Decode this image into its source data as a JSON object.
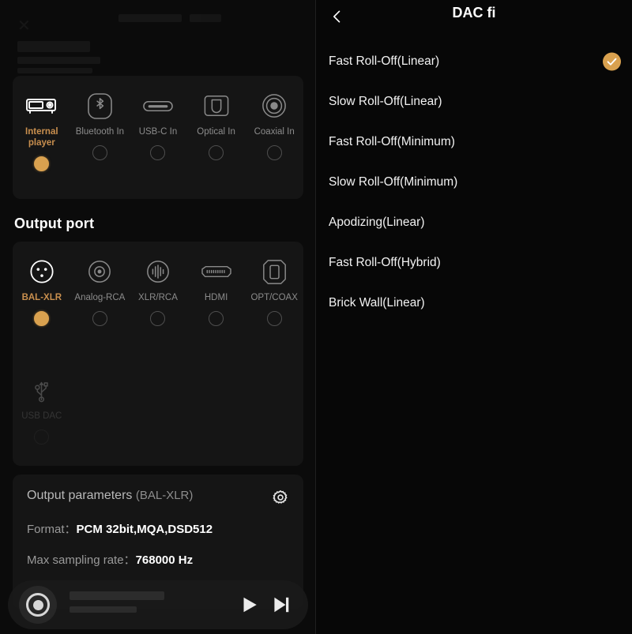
{
  "theme": {
    "accent": "#d9a14f",
    "accent_text": "#c98f4e",
    "bg": "#0b0b0b",
    "card_bg": "#151515",
    "text_primary": "#ffffff",
    "text_secondary": "#9a9a9a",
    "text_dim": "#5a5a5a"
  },
  "left": {
    "input_sources": [
      {
        "label": "Internal player",
        "icon": "dap-player-icon",
        "selected": true,
        "enabled": true
      },
      {
        "label": "Bluetooth In",
        "icon": "bluetooth-icon",
        "selected": false,
        "enabled": true
      },
      {
        "label": "USB-C In",
        "icon": "usb-c-icon",
        "selected": false,
        "enabled": true
      },
      {
        "label": "Optical In",
        "icon": "optical-icon",
        "selected": false,
        "enabled": true
      },
      {
        "label": "Coaxial In",
        "icon": "coaxial-icon",
        "selected": false,
        "enabled": true
      }
    ],
    "output_section_title": "Output port",
    "output_ports": [
      {
        "label": "BAL-XLR",
        "icon": "xlr-connector-icon",
        "selected": true,
        "enabled": true
      },
      {
        "label": "Analog-RCA",
        "icon": "rca-jack-icon",
        "selected": false,
        "enabled": true
      },
      {
        "label": "XLR/RCA",
        "icon": "waveform-icon",
        "selected": false,
        "enabled": true
      },
      {
        "label": "HDMI",
        "icon": "hdmi-port-icon",
        "selected": false,
        "enabled": true
      },
      {
        "label": "OPT/COAX",
        "icon": "toslink-icon",
        "selected": false,
        "enabled": true
      }
    ],
    "usb_dac": {
      "label": "USB DAC",
      "icon": "usb-icon",
      "selected": false,
      "enabled": false
    },
    "params": {
      "title": "Output parameters",
      "port": "(BAL-XLR)",
      "gear_icon": "gear-icon",
      "format_label": "Format：",
      "format_value": "PCM 32bit,MQA,DSD512",
      "rate_label": "Max sampling rate：",
      "rate_value": "768000 Hz"
    },
    "player": {
      "album_art_icon": "vinyl-record-icon",
      "play_icon": "play-icon",
      "next_icon": "next-track-icon"
    }
  },
  "right": {
    "back_icon": "chevron-left-icon",
    "title": "DAC fi",
    "check_icon": "check-icon",
    "filters": [
      {
        "label": "Fast Roll-Off(Linear)",
        "selected": true
      },
      {
        "label": "Slow Roll-Off(Linear)",
        "selected": false
      },
      {
        "label": "Fast Roll-Off(Minimum)",
        "selected": false
      },
      {
        "label": "Slow Roll-Off(Minimum)",
        "selected": false
      },
      {
        "label": "Apodizing(Linear)",
        "selected": false
      },
      {
        "label": "Fast Roll-Off(Hybrid)",
        "selected": false
      },
      {
        "label": "Brick Wall(Linear)",
        "selected": false
      }
    ]
  }
}
